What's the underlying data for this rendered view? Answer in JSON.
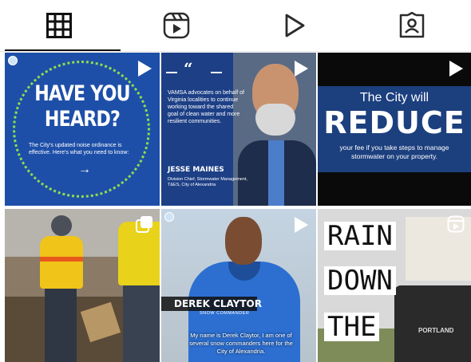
{
  "tabs": [
    {
      "name": "posts",
      "icon": "grid-icon",
      "active": true
    },
    {
      "name": "reels",
      "icon": "reels-icon",
      "active": false
    },
    {
      "name": "videos",
      "icon": "play-icon",
      "active": false
    },
    {
      "name": "tagged",
      "icon": "tagged-person-icon",
      "active": false
    }
  ],
  "posts": [
    {
      "type": "reel",
      "line1": "HAVE YOU",
      "line2": "HEARD?",
      "body": "The City's updated noise ordinance is effective. Here's what you need to know:"
    },
    {
      "type": "reel",
      "quote_mark": "“",
      "body": "VAMSA advocates on behalf of Virginia localities to continue working toward the shared goal of clean water and more resilient communities.",
      "name": "JESSE MAINES",
      "role": "Division Chief, Stormwater Management, T&ES, City of Alexandria"
    },
    {
      "type": "reel",
      "line1": "The City will",
      "line2": "REDUCE",
      "line3": "your fee if you take steps to manage stormwater on your property."
    },
    {
      "type": "carousel"
    },
    {
      "type": "reel",
      "name": "DEREK CLAYTOR",
      "title": "SNOW COMMANDER",
      "caption": "My name is Derek Claytor, I am one of several snow commanders here for the City of Alexandria."
    },
    {
      "type": "reel",
      "words": [
        "RAIN",
        "DOWN",
        "THE"
      ],
      "brand": "PORTLAND"
    }
  ],
  "colors": {
    "tab_icon": "#2b2b2b",
    "active_underline": "#111111",
    "noise_ring": "#8be04e"
  }
}
